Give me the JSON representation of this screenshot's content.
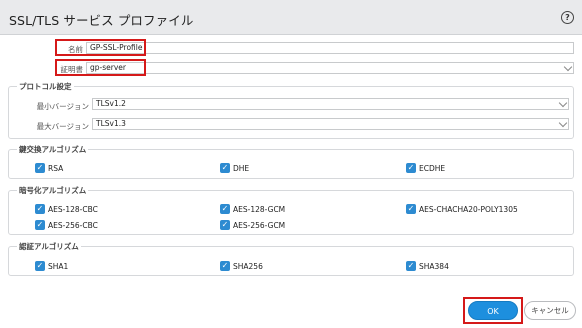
{
  "dialog": {
    "title": "SSL/TLS サービス プロファイル",
    "help_icon": "question-circle-icon",
    "help_glyph": "?"
  },
  "profile": {
    "name_label": "名前",
    "name_value": "GP-SSL-Profile",
    "certificate_label": "証明書",
    "certificate_value": "gp-server"
  },
  "protocol": {
    "legend": "プロトコル設定",
    "min_label": "最小バージョン",
    "min_value": "TLSv1.2",
    "max_label": "最大バージョン",
    "max_value": "TLSv1.3"
  },
  "key_exchange": {
    "legend": "鍵交換アルゴリズム",
    "items": [
      {
        "label": "RSA",
        "checked": true
      },
      {
        "label": "DHE",
        "checked": true
      },
      {
        "label": "ECDHE",
        "checked": true
      }
    ]
  },
  "encryption": {
    "legend": "暗号化アルゴリズム",
    "items": [
      {
        "label": "AES-128-CBC",
        "checked": true
      },
      {
        "label": "AES-128-GCM",
        "checked": true
      },
      {
        "label": "AES-CHACHA20-POLY1305",
        "checked": true
      },
      {
        "label": "AES-256-CBC",
        "checked": true
      },
      {
        "label": "AES-256-GCM",
        "checked": true
      }
    ]
  },
  "authentication": {
    "legend": "認証アルゴリズム",
    "items": [
      {
        "label": "SHA1",
        "checked": true
      },
      {
        "label": "SHA256",
        "checked": true
      },
      {
        "label": "SHA384",
        "checked": true
      }
    ]
  },
  "buttons": {
    "ok": "OK",
    "cancel": "キャンセル"
  },
  "colors": {
    "highlight": "#d51919",
    "accent": "#1d8fde",
    "checkbox": "#2d8bd1"
  }
}
